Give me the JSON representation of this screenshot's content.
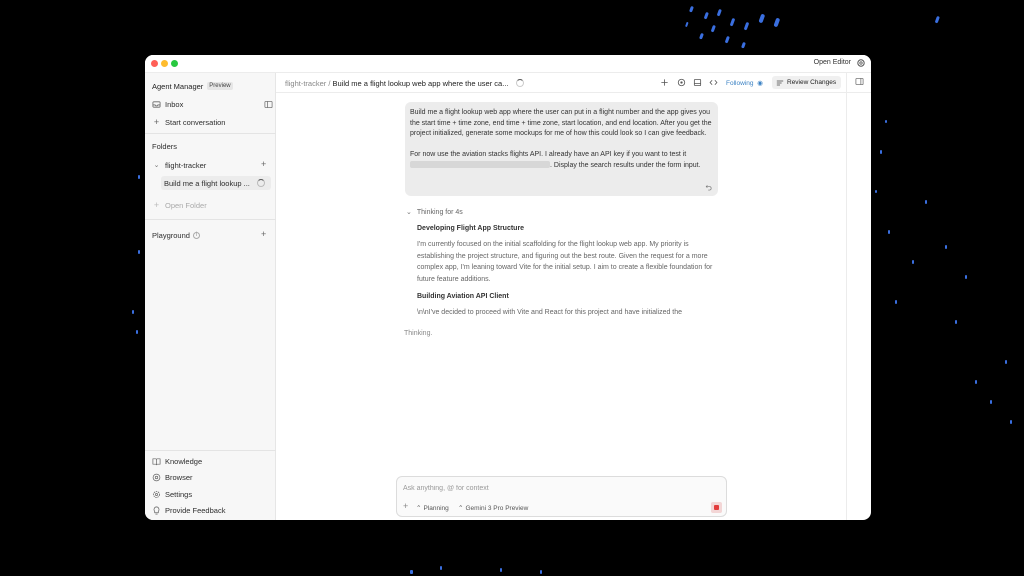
{
  "titlebar": {
    "open_editor": "Open Editor"
  },
  "sidebar": {
    "app_name": "Agent Manager",
    "app_badge": "Preview",
    "inbox": "Inbox",
    "start_conversation": "Start conversation",
    "folders_heading": "Folders",
    "folder_name": "flight-tracker",
    "conversation_item": "Build me a flight lookup ...",
    "open_folder": "Open Folder",
    "playground": "Playground",
    "bottom": {
      "knowledge": "Knowledge",
      "browser": "Browser",
      "settings": "Settings",
      "feedback": "Provide Feedback"
    }
  },
  "header": {
    "breadcrumb_project": "flight-tracker",
    "breadcrumb_sep": "/",
    "breadcrumb_title": "Build me a flight lookup web app where the user ca...",
    "following": "Following",
    "review_changes": "Review Changes"
  },
  "conversation": {
    "user_message_p1": "Build me a flight lookup web app where the user can put in a flight number and the app gives you the start time + time zone, end time + time zone, start location, and end location. After you get the project initialized, generate some mockups for me of how this could look so I can give feedback.",
    "user_message_p2_before": "For now use the aviation stacks flights API. I already have an API key if you want to test it",
    "user_message_p2_after": ". Display the search results under the form input.",
    "thinking_label": "Thinking for 4s",
    "thoughts": [
      {
        "heading": "Developing Flight App Structure",
        "text": "I'm currently focused on the initial scaffolding for the flight lookup web app. My priority is establishing the project structure, and figuring out the best route. Given the request for a more complex app, I'm leaning toward Vite for the initial setup. I aim to create a flexible foundation for future feature additions."
      },
      {
        "heading": "Building Aviation API Client",
        "text": "\\n\\nI've decided to proceed with Vite and React for this project and have initialized the"
      }
    ],
    "status": "Thinking."
  },
  "composer": {
    "placeholder": "Ask anything, @ for context",
    "mode": "Planning",
    "model": "Gemini 3 Pro Preview"
  },
  "colors": {
    "accent_blue": "#3b82c4",
    "stop_red": "#e23c3c",
    "background": "#000000"
  }
}
